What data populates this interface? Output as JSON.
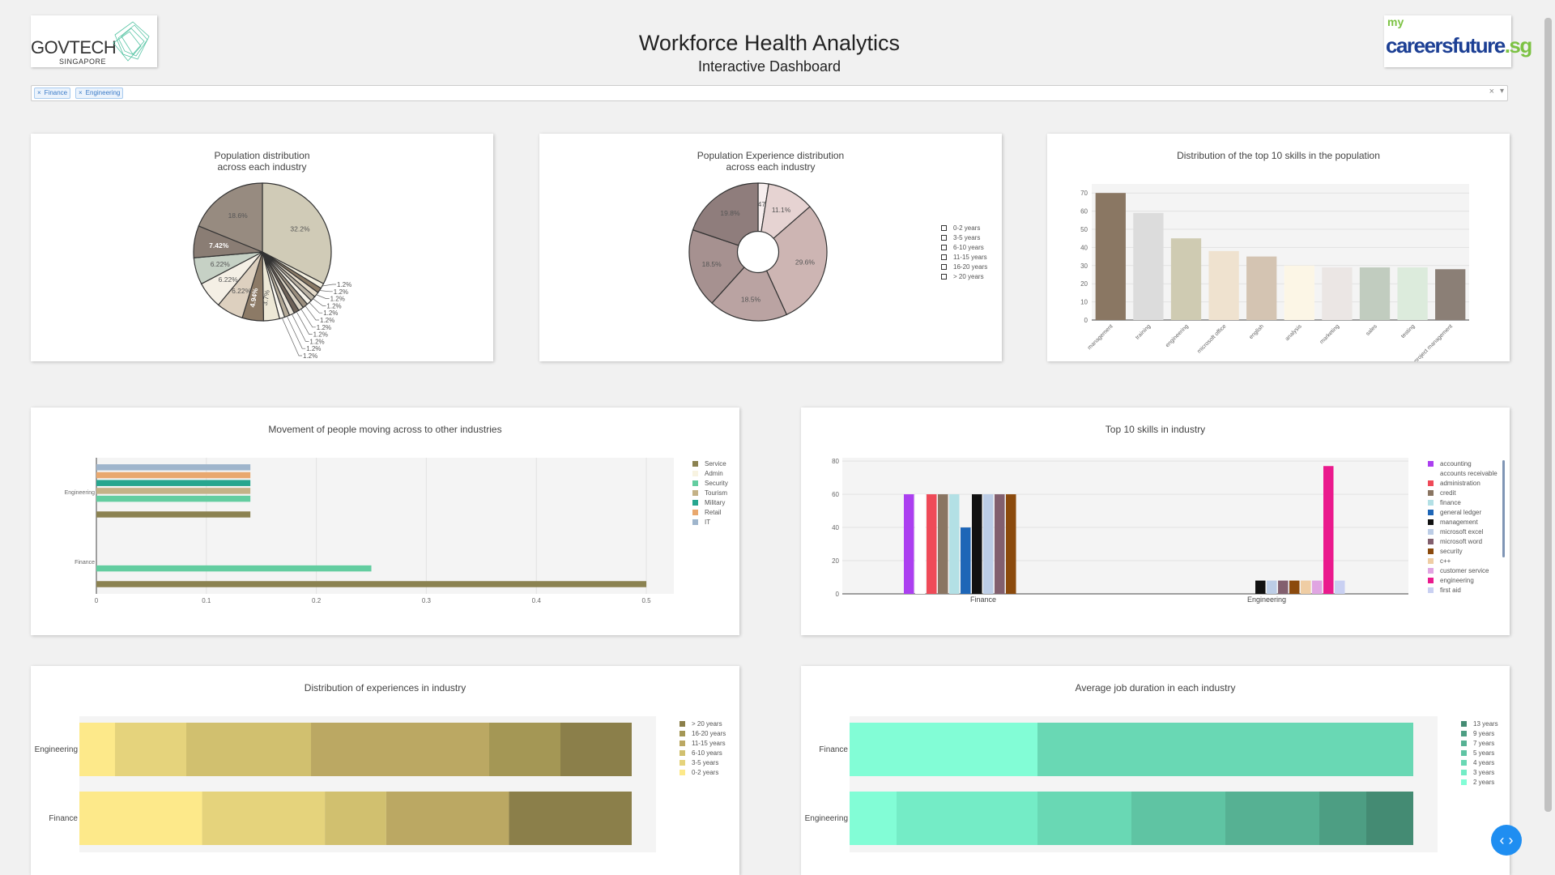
{
  "header": {
    "title": "Workforce Health Analytics",
    "subtitle": "Interactive Dashboard",
    "logo_left_line1": "GOVTECH",
    "logo_left_line2": "SINGAPORE",
    "logo_right_small": "my",
    "logo_right_main": "careersfuture",
    "logo_right_suffix": ".sg"
  },
  "filter": {
    "chips": [
      {
        "label": "Finance"
      },
      {
        "label": "Engineering"
      }
    ],
    "remove_glyph": "×",
    "clear_glyph": "×",
    "dropdown_glyph": "▾"
  },
  "colors": {
    "accent": "#1f8ef1",
    "chip_text": "#3b7bc7"
  },
  "fab": {
    "label": "‹ ›"
  },
  "chart_data": [
    {
      "id": "pop_dist",
      "type": "pie",
      "title_line1": "Population distribution",
      "title_line2": "across each industry",
      "values": [
        32.2,
        1.2,
        1.2,
        1.2,
        1.2,
        1.2,
        1.2,
        1.2,
        1.2,
        1.2,
        1.2,
        1.2,
        3.7,
        4.94,
        6.22,
        6.22,
        6.22,
        7.42,
        18.6
      ],
      "labels": [
        "32.2%",
        "1.2%",
        "1.2%",
        "1.2%",
        "1.2%",
        "1.2%",
        "1.2%",
        "1.2%",
        "1.2%",
        "1.2%",
        "1.2%",
        "1.2%",
        "3.7%",
        "4.94%",
        "6.22%",
        "6.22%",
        "6.22%",
        "7.42%",
        "18.6%"
      ],
      "colors": [
        "#d0cbb7",
        "#f3efdf",
        "#8a7a66",
        "#e6dccb",
        "#bcb4a6",
        "#f8f4ea",
        "#9c9080",
        "#dcd4c4",
        "#6e6258",
        "#ece6da",
        "#b4aa98",
        "#fbf8f0",
        "#ede8d6",
        "#8c7a66",
        "#ddd0bf",
        "#f4efe5",
        "#c6d1c5",
        "#8a7d74",
        "#978b80"
      ]
    },
    {
      "id": "exp_dist",
      "type": "pie",
      "hole": 0.3,
      "title_line1": "Population Experience distribution",
      "title_line2": "across each industry",
      "values": [
        2.47,
        11.1,
        29.6,
        18.5,
        18.5,
        19.8
      ],
      "labels": [
        "2.47%",
        "11.1%",
        "29.6%",
        "18.5%",
        "18.5%",
        "19.8%"
      ],
      "legend": [
        "0-2 years",
        "3-5 years",
        "6-10 years",
        "11-15 years",
        "16-20 years",
        "> 20 years"
      ],
      "colors": [
        "#f7eeee",
        "#e6d3d2",
        "#cdb5b3",
        "#baa3a2",
        "#a69190",
        "#8f7d7c"
      ]
    },
    {
      "id": "top_skills_pop",
      "type": "bar",
      "title": "Distribution of the top 10 skills in the population",
      "categories": [
        "management",
        "training",
        "engineering",
        "microsoft office",
        "english",
        "analysis",
        "marketing",
        "sales",
        "testing",
        "project management"
      ],
      "values": [
        70,
        59,
        45,
        38,
        35,
        30,
        29,
        29,
        29,
        28
      ],
      "colors": [
        "#8a7763",
        "#dcdcdc",
        "#cfcbb2",
        "#efe2cf",
        "#d4c4b2",
        "#fcf6e6",
        "#ebe6e4",
        "#c1ccbf",
        "#dcebdc",
        "#8b7f76"
      ],
      "ylim": [
        0,
        75
      ],
      "yticks": [
        "0",
        "10",
        "20",
        "30",
        "40",
        "50",
        "60",
        "70"
      ]
    },
    {
      "id": "movement",
      "type": "bar",
      "orientation": "horizontal",
      "title": "Movement of people moving across to other industries",
      "categories": [
        "Finance",
        "Engineering"
      ],
      "series": [
        {
          "name": "Service",
          "values": [
            0.5,
            0.14
          ],
          "color": "#8b8251"
        },
        {
          "name": "Admin",
          "values": [
            0.0,
            0.0
          ],
          "color": "#f8f3e1"
        },
        {
          "name": "Security",
          "values": [
            0.25,
            0.14
          ],
          "color": "#63cda0"
        },
        {
          "name": "Tourism",
          "values": [
            0.0,
            0.14
          ],
          "color": "#c4b287"
        },
        {
          "name": "Military",
          "values": [
            0.0,
            0.14
          ],
          "color": "#27a68f"
        },
        {
          "name": "Retail",
          "values": [
            0.0,
            0.14
          ],
          "color": "#e9a86e"
        },
        {
          "name": "IT",
          "values": [
            0.0,
            0.14
          ],
          "color": "#9fb5cc"
        }
      ],
      "xlim": [
        0,
        0.525
      ],
      "xticks": [
        "0",
        "0.1",
        "0.2",
        "0.3",
        "0.4",
        "0.5"
      ]
    },
    {
      "id": "top_skills_industry",
      "type": "bar",
      "title": "Top 10 skills in industry",
      "categories": [
        "Finance",
        "Engineering"
      ],
      "series": [
        {
          "name": "accounting",
          "values": [
            60,
            null
          ],
          "color": "#ab3ff0"
        },
        {
          "name": "accounts receivable",
          "values": [
            60,
            null
          ],
          "color": "#ffffff"
        },
        {
          "name": "administration",
          "values": [
            60,
            null
          ],
          "color": "#ef4a58"
        },
        {
          "name": "credit",
          "values": [
            60,
            null
          ],
          "color": "#8a7562"
        },
        {
          "name": "finance",
          "values": [
            60,
            null
          ],
          "color": "#b3e0e5"
        },
        {
          "name": "general ledger",
          "values": [
            40,
            null
          ],
          "color": "#1e66b7"
        },
        {
          "name": "management",
          "values": [
            60,
            8
          ],
          "color": "#111111"
        },
        {
          "name": "microsoft excel",
          "values": [
            60,
            8
          ],
          "color": "#bccde6"
        },
        {
          "name": "microsoft word",
          "values": [
            60,
            8
          ],
          "color": "#825f6e"
        },
        {
          "name": "security",
          "values": [
            60,
            8
          ],
          "color": "#8b4a0d"
        },
        {
          "name": "c++",
          "values": [
            null,
            8
          ],
          "color": "#efcda4"
        },
        {
          "name": "customer service",
          "values": [
            null,
            8
          ],
          "color": "#e0a5e2"
        },
        {
          "name": "engineering",
          "values": [
            null,
            77
          ],
          "color": "#ea1a8d"
        },
        {
          "name": "first aid",
          "values": [
            null,
            8
          ],
          "color": "#c9d0f2"
        }
      ],
      "ylim": [
        0,
        82
      ],
      "yticks": [
        "0",
        "20",
        "40",
        "60",
        "80"
      ]
    },
    {
      "id": "exp_in_industry",
      "type": "bar",
      "orientation": "horizontal",
      "stacked": true,
      "title": "Distribution of experiences in industry",
      "categories": [
        "Engineering",
        "Finance"
      ],
      "series": [
        {
          "name": "0-2 years",
          "values": [
            1,
            2
          ],
          "color": "#fde98a"
        },
        {
          "name": "3-5 years",
          "values": [
            2,
            2
          ],
          "color": "#e5d37c"
        },
        {
          "name": "6-10 years",
          "values": [
            3.5,
            1
          ],
          "color": "#d1c06f"
        },
        {
          "name": "11-15 years",
          "values": [
            5,
            2
          ],
          "color": "#bba863"
        },
        {
          "name": "16-20 years",
          "values": [
            2,
            0
          ],
          "color": "#a49755"
        },
        {
          "name": "> 20 years",
          "values": [
            2,
            2
          ],
          "color": "#8b7f4a"
        }
      ]
    },
    {
      "id": "job_duration",
      "type": "bar",
      "orientation": "horizontal",
      "stacked": true,
      "title": "Average job duration in each industry",
      "categories": [
        "Finance",
        "Engineering"
      ],
      "series": [
        {
          "name": "2 years",
          "values": [
            2,
            1
          ],
          "color": "#82fdd6"
        },
        {
          "name": "3 years",
          "values": [
            0,
            3
          ],
          "color": "#74ecc6"
        },
        {
          "name": "4 years",
          "values": [
            4,
            2
          ],
          "color": "#69d8b4"
        },
        {
          "name": "5 years",
          "values": [
            0,
            2
          ],
          "color": "#5fc4a3"
        },
        {
          "name": "7 years",
          "values": [
            0,
            2
          ],
          "color": "#56b193"
        },
        {
          "name": "9 years",
          "values": [
            0,
            1
          ],
          "color": "#4d9e83"
        },
        {
          "name": "13 years",
          "values": [
            0,
            1
          ],
          "color": "#448b73"
        }
      ]
    }
  ]
}
